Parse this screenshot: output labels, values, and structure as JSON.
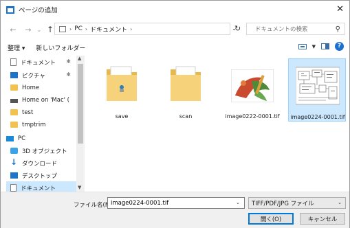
{
  "window": {
    "title": "ページの追加",
    "close_symbol": "✕"
  },
  "nav": {
    "back": "←",
    "forward": "→",
    "recent": "⌄",
    "up": "↑",
    "breadcrumbs": [
      "PC",
      "ドキュメント"
    ],
    "sep": "›",
    "refresh": "↻",
    "dropdown": "⌄"
  },
  "search": {
    "placeholder": "ドキュメントの検索",
    "icon": "search-icon"
  },
  "toolbar": {
    "organize": "整理 ▾",
    "new_folder": "新しいフォルダー",
    "help": "?"
  },
  "sidebar": {
    "items": [
      {
        "label": "ドキュメント",
        "icon": "document-icon",
        "pinned": true
      },
      {
        "label": "ピクチャ",
        "icon": "pictures-icon",
        "pinned": true
      },
      {
        "label": "Home",
        "icon": "folder-icon",
        "pinned": false
      },
      {
        "label": "Home on 'Mac' (",
        "icon": "network-drive-icon",
        "pinned": false
      },
      {
        "label": "test",
        "icon": "folder-icon",
        "pinned": false
      },
      {
        "label": "tmptrim",
        "icon": "folder-icon",
        "pinned": false
      },
      {
        "label": "PC",
        "icon": "pc-icon",
        "pinned": false
      },
      {
        "label": "3D オブジェクト",
        "icon": "3d-objects-icon",
        "pinned": false
      },
      {
        "label": "ダウンロード",
        "icon": "download-icon",
        "pinned": false
      },
      {
        "label": "デスクトップ",
        "icon": "desktop-icon",
        "pinned": false
      },
      {
        "label": "ドキュメント",
        "icon": "document-icon",
        "pinned": false
      }
    ],
    "pin_symbol": "✱"
  },
  "files": [
    {
      "name": "save",
      "kind": "folder"
    },
    {
      "name": "scan",
      "kind": "folder"
    },
    {
      "name": "image0222-0001.tif",
      "kind": "image-photo"
    },
    {
      "name": "image0224-0001.tif",
      "kind": "image-drawing"
    }
  ],
  "bottom": {
    "filename_label": "ファイル名(N):",
    "filename_value": "image0224-0001.tif",
    "filetype": "TIFF/PDF/JPG ファイル",
    "open_label": "開く(O)",
    "cancel_label": "キャンセル"
  },
  "colors": {
    "accent": "#0078d7",
    "selection": "#cce8ff",
    "folder": "#f2c14e"
  }
}
